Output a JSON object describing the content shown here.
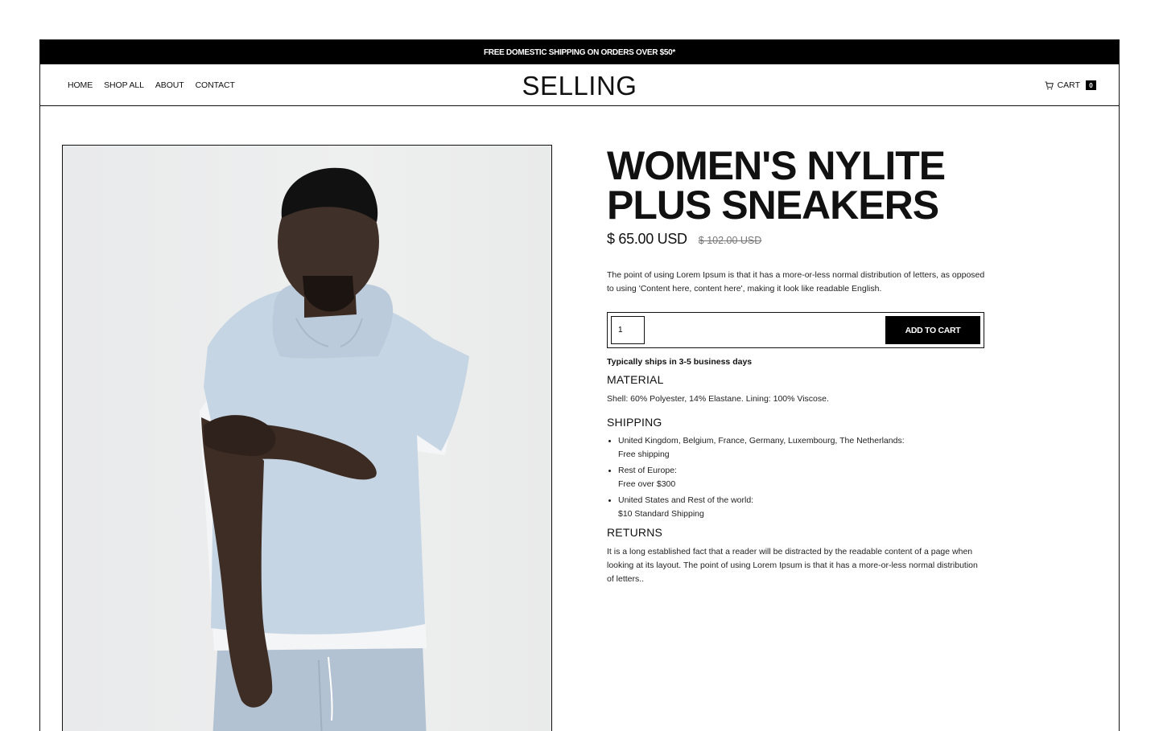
{
  "promo": {
    "text": "FREE DOMESTIC SHIPPING ON ORDERS OVER $50*"
  },
  "header": {
    "nav": [
      "HOME",
      "SHOP ALL",
      "ABOUT",
      "CONTACT"
    ],
    "logo": "SELLING",
    "cart_label": "CART",
    "cart_count": "0"
  },
  "product": {
    "title": "WOMEN'S NYLITE PLUS SNEAKERS",
    "price": "$ 65.00 USD",
    "compare_price": "$ 102.00 USD",
    "description": "The point of using Lorem Ipsum is that it has a more-or-less normal distribution of letters, as opposed to using 'Content here, content here', making it look like readable English.",
    "quantity": "1",
    "add_to_cart": "ADD TO CART",
    "ships_note": "Typically ships in 3-5 business days",
    "image_icon": "model-in-light-blue-hoodie-photo"
  },
  "material": {
    "heading": "MATERIAL",
    "text": "Shell: 60% Polyester, 14% Elastane. Lining: 100% Viscose."
  },
  "shipping": {
    "heading": "SHIPPING",
    "items": [
      {
        "region": "United Kingdom, Belgium, France, Germany, Luxembourg, The Netherlands:",
        "detail": "Free shipping"
      },
      {
        "region": "Rest of Europe:",
        "detail": "Free over $300"
      },
      {
        "region": "United States and Rest of the world:",
        "detail": "$10 Standard Shipping"
      }
    ]
  },
  "returns": {
    "heading": "RETURNS",
    "text": "It is a long established fact that a reader will be distracted by the readable content of a page when looking at its layout. The point of using Lorem Ipsum is that it has a more-or-less normal distribution of letters.."
  },
  "colors": {
    "accent": "#000000",
    "background": "#ffffff",
    "muted": "#777777"
  }
}
